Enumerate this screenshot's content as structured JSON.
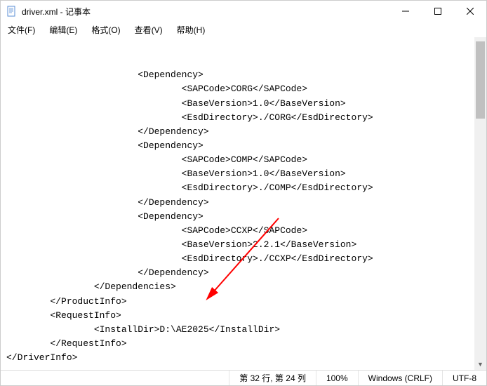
{
  "window": {
    "title": "driver.xml - 记事本"
  },
  "menu": {
    "file": "文件(F)",
    "edit": "编辑(E)",
    "format": "格式(O)",
    "view": "查看(V)",
    "help": "帮助(H)"
  },
  "icons": {
    "notepad": "notepad-icon",
    "min": "minimize-icon",
    "max": "maximize-icon",
    "close": "close-icon"
  },
  "xml_lines": [
    "                        <Dependency>",
    "                                <SAPCode>CORG</SAPCode>",
    "                                <BaseVersion>1.0</BaseVersion>",
    "                                <EsdDirectory>./CORG</EsdDirectory>",
    "                        </Dependency>",
    "                        <Dependency>",
    "                                <SAPCode>COMP</SAPCode>",
    "                                <BaseVersion>1.0</BaseVersion>",
    "                                <EsdDirectory>./COMP</EsdDirectory>",
    "                        </Dependency>",
    "                        <Dependency>",
    "                                <SAPCode>CCXP</SAPCode>",
    "                                <BaseVersion>2.2.1</BaseVersion>",
    "                                <EsdDirectory>./CCXP</EsdDirectory>",
    "                        </Dependency>",
    "                </Dependencies>",
    "        </ProductInfo>",
    "        <RequestInfo>",
    "                <InstallDir>D:\\AE2025</InstallDir>",
    "        </RequestInfo>",
    "</DriverInfo>"
  ],
  "status": {
    "position": "第 32 行, 第 24 列",
    "zoom": "100%",
    "eol": "Windows (CRLF)",
    "encoding": "UTF-8"
  }
}
